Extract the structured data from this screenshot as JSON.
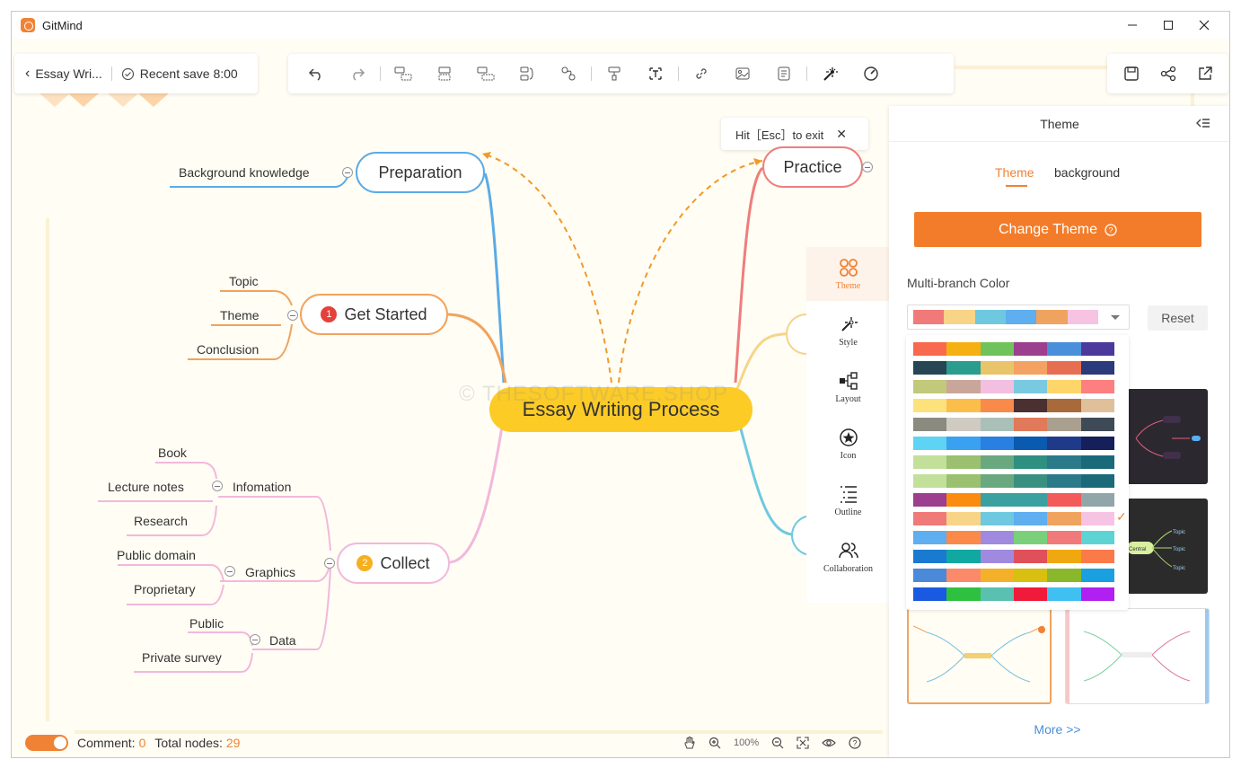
{
  "app": {
    "title": "GitMind"
  },
  "window_controls": {
    "minimize": "—",
    "maximize": "☐",
    "close": "✕"
  },
  "header": {
    "back_label": "Essay Wri...",
    "save_status": "Recent save 8:00"
  },
  "toolbar": {
    "icons": [
      "undo-icon",
      "redo-icon",
      "sibling-node-icon",
      "child-node-icon",
      "parent-node-icon",
      "summary-icon",
      "relation-icon",
      "format-painter-icon",
      "text-box-icon",
      "link-icon",
      "image-icon",
      "note-icon",
      "style-magic-icon",
      "start-icon"
    ]
  },
  "right_actions": {
    "icons": [
      "save-icon",
      "share-icon",
      "export-icon"
    ]
  },
  "esc_hint": {
    "pre": "Hit［Esc］to exit",
    "close": "✕"
  },
  "mindmap": {
    "central": "Essay Writing Process",
    "preparation": {
      "label": "Preparation",
      "children": [
        "Background knowledge"
      ]
    },
    "get_started": {
      "number": "1",
      "label": "Get Started",
      "children": [
        "Topic",
        "Theme",
        "Conclusion"
      ]
    },
    "collect": {
      "number": "2",
      "label": "Collect",
      "infomation": {
        "label": "Infomation",
        "children": [
          "Book",
          "Lecture notes",
          "Research"
        ]
      },
      "graphics": {
        "label": "Graphics",
        "children": [
          "Public domain",
          "Proprietary"
        ]
      },
      "data": {
        "label": "Data",
        "children": [
          "Public",
          "Private survey"
        ]
      }
    },
    "practice": {
      "label": "Practice"
    },
    "watermark": "© THESOFTWARE.SHOP"
  },
  "side_rail": {
    "items": [
      {
        "label": "Theme",
        "icon": "theme-icon"
      },
      {
        "label": "Style",
        "icon": "style-icon"
      },
      {
        "label": "Layout",
        "icon": "layout-icon"
      },
      {
        "label": "Icon",
        "icon": "icon-star-icon"
      },
      {
        "label": "Outline",
        "icon": "outline-icon"
      },
      {
        "label": "Collaboration",
        "icon": "collaboration-icon"
      }
    ]
  },
  "panel": {
    "title": "Theme",
    "tabs": {
      "theme": "Theme",
      "background": "background"
    },
    "change_theme_label": "Change Theme",
    "multi_branch_label": "Multi-branch Color",
    "reset_label": "Reset",
    "more_label": "More >>",
    "selected_palette": [
      "#f07a7a",
      "#f7d488",
      "#6ec9e0",
      "#5eaef0",
      "#f0a35e",
      "#f7c3e3"
    ],
    "palettes": [
      [
        "#f9694d",
        "#f5b012",
        "#6fc35a",
        "#9b3f8e",
        "#4a8fd9",
        "#4b3a9b"
      ],
      [
        "#264653",
        "#2a9d8f",
        "#e9c46a",
        "#f4a261",
        "#e76f51",
        "#2b3a7a"
      ],
      [
        "#c2c97a",
        "#c9a69a",
        "#f2bfe0",
        "#79c9e0",
        "#fdd56a",
        "#fd7f7f"
      ],
      [
        "#fde17a",
        "#fcbe4a",
        "#fa8a4a",
        "#4a3030",
        "#a86a3a",
        "#e0c09a"
      ],
      [
        "#8a8a80",
        "#cfcbc2",
        "#aabfb8",
        "#e07a5a",
        "#aaa090",
        "#3e4a56"
      ],
      [
        "#5ed3f3",
        "#3aa0f0",
        "#2a80e0",
        "#0a5ab0",
        "#203a8a",
        "#151f5a"
      ],
      [
        "#c2e09a",
        "#9ac070",
        "#6aa880",
        "#2e9080",
        "#2a7a8a",
        "#1a6a7a"
      ],
      [
        "#c2e09a",
        "#9ac070",
        "#6aa880",
        "#3a9080",
        "#2a7a8a",
        "#1a6a7a"
      ],
      [
        "#9b3f8e",
        "#fb8c0f",
        "#3aa0a0",
        "#3aa0a0",
        "#f35a5a",
        "#92a6aa"
      ],
      [
        "#f07a7a",
        "#f7d488",
        "#6ec9e0",
        "#5eaef0",
        "#f0a35e",
        "#f7c3e3"
      ],
      [
        "#5eaef0",
        "#fb8a4a",
        "#a08ae0",
        "#7ad07a",
        "#f07a7a",
        "#5ed3d3"
      ],
      [
        "#1a7ad0",
        "#10a8a0",
        "#a08ae0",
        "#e0505a",
        "#f0a810",
        "#fb7a4a"
      ],
      [
        "#4a8ad9",
        "#fb8a6a",
        "#f5b02a",
        "#d9c010",
        "#8ab82a",
        "#1aa0e0"
      ],
      [
        "#1a5ae0",
        "#30c040",
        "#5ac0b0",
        "#f01a3a",
        "#40c0f0",
        "#b020f0"
      ]
    ],
    "selected_palette_index": 9,
    "check_mark": "✓",
    "theme_thumbs": [
      "dark-theme-1",
      "dark-theme-2",
      "light-theme-1",
      "light-theme-2"
    ],
    "thumb_words": {
      "central": "Central",
      "topic": "Topic"
    }
  },
  "bottom": {
    "comment_label": "Comment:",
    "comment_count": "0",
    "total_label": "Total nodes:",
    "total_count": "29",
    "zoom": "100%",
    "accent": "#f08236"
  }
}
